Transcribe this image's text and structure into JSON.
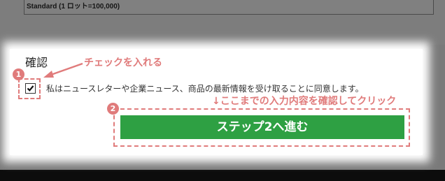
{
  "background": {
    "top_text": "Standard (1 ロット=100,000)"
  },
  "form": {
    "section_label": "確認",
    "checkbox_checked": true,
    "consent_text": "私はニュースレターや企業ニュース、商品の最新情報を受け取ることに同意します。",
    "step_button_label": "ステップ2へ進む"
  },
  "annotations": {
    "badge_1": "1",
    "badge_2": "2",
    "check_note": "チェックを入れる",
    "click_note": "↓ここまでの入力内容を確認してクリック"
  },
  "colors": {
    "accent": "#e07b7b",
    "button": "#2ea043",
    "overlay": "#7a7a7a"
  },
  "icons": {
    "checkmark": "checkmark-icon",
    "arrow": "pointer-arrow-icon"
  }
}
